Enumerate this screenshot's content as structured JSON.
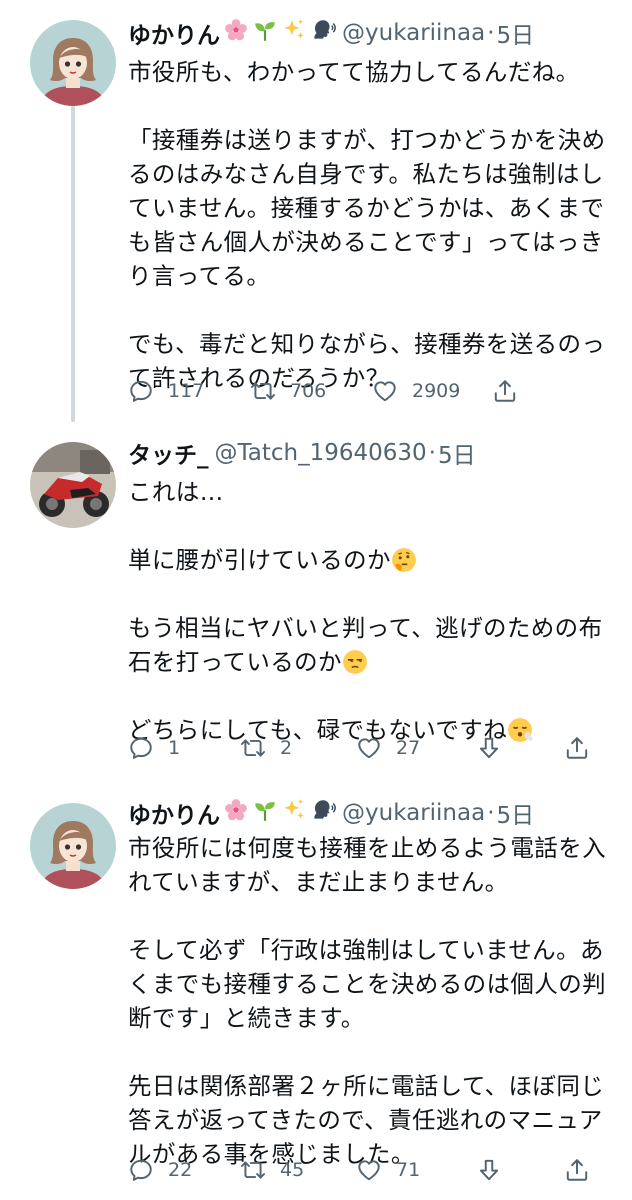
{
  "tweets": [
    {
      "name": "ゆかりん",
      "handle": "@yukariinaa",
      "separator": "·",
      "time": "5日",
      "paragraphs": [
        "市役所も、わかってて協力してるんだね。",
        "「接種券は送りますが、打つかどうかを決めるのはみなさん自身です。私たちは強制はしていません。接種するかどうかは、あくまでも皆さん個人が決めることです」ってはっきり言ってる。",
        "でも、毒だと知りながら、接種券を送るのって許されるのだろうか？"
      ],
      "reply_count": "117",
      "retweet_count": "706",
      "like_count": "2909"
    },
    {
      "name": "タッチ_",
      "handle": "@Tatch_19640630",
      "separator": "·",
      "time": "5日",
      "p1": "これは…",
      "p2": "単に腰が引けているのか",
      "p3": "もう相当にヤバいと判って、逃げのための布石を打っているのか",
      "p4": "どちらにしても、碌でもないですね",
      "reply_count": "1",
      "retweet_count": "2",
      "like_count": "27"
    },
    {
      "name": "ゆかりん",
      "handle": "@yukariinaa",
      "separator": "·",
      "time": "5日",
      "paragraphs": [
        "市役所には何度も接種を止めるよう電話を入れていますが、まだ止まりません。",
        "そして必ず「行政は強制はしていません。あくまでも接種することを決めるのは個人の判断です」と続きます。",
        "先日は関係部署２ヶ所に電話して、ほぼ同じ答えが返ってきたので、責任逃れのマニュアルがある事を感じました。"
      ],
      "reply_count": "22",
      "retweet_count": "45",
      "like_count": "71"
    }
  ],
  "icons": {
    "reply": "reply-icon",
    "retweet": "retweet-icon",
    "like": "heart-icon",
    "share": "share-icon",
    "downvote": "downvote-icon"
  },
  "colors": {
    "text": "#0f1419",
    "secondary": "#536471",
    "thread_line": "#cfd9de"
  }
}
